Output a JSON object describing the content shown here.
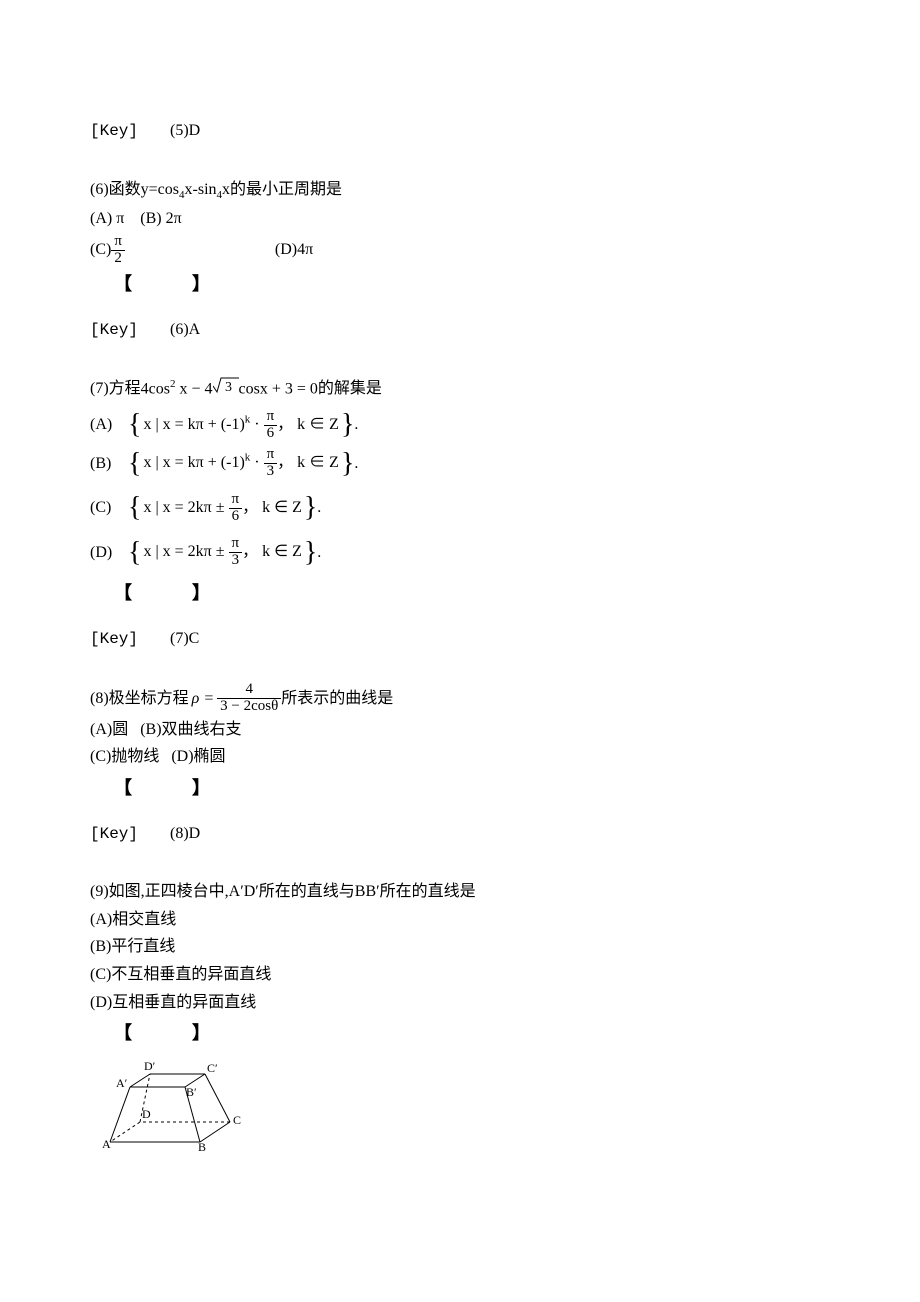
{
  "key_label": "[Key]",
  "bracket_symbol": "【　　】",
  "q5_key": "(5)D",
  "q6": {
    "stem_prefix": "(6)函数y=cos",
    "stem_sub": "4",
    "stem_mid": "x-sin",
    "stem_sub2": "4",
    "stem_suffix": "x的最小正周期是",
    "a_label": "(A)",
    "a_val": "π",
    "b_label": "(B)",
    "b_val": "2π",
    "c_label": "(C)",
    "c_num": "π",
    "c_den": "2",
    "d_label": "(D)",
    "d_val": "4π",
    "key": "(6)A"
  },
  "q7": {
    "stem_prefix": "(7)方程",
    "eq_a": "4cos",
    "eq_exp": "2",
    "eq_b": "x − 4",
    "eq_sqrt": "3",
    "eq_c": "cosx + 3 = 0",
    "stem_suffix": "的解集是",
    "a_label": "(A)",
    "a_body_pre": "x | x = kπ + (-1)",
    "a_body_exp": "k",
    "a_body_mid": " · ",
    "a_num": "π",
    "a_den": "6",
    "a_body_post": "， k ∈ Z",
    "b_label": "(B)",
    "b_body_pre": "x | x = kπ + (-1)",
    "b_body_exp": "k",
    "b_body_mid": " · ",
    "b_num": "π",
    "b_den": "3",
    "b_body_post": "， k ∈ Z",
    "c_label": "(C)",
    "c_body_pre": "x | x = 2kπ ± ",
    "c_num": "π",
    "c_den": "6",
    "c_body_post": "， k ∈ Z",
    "d_label": "(D)",
    "d_body_pre": "x | x = 2kπ ± ",
    "d_num": "π",
    "d_den": "3",
    "d_body_post": "， k ∈ Z",
    "key": "(7)C"
  },
  "q8": {
    "stem_prefix": "(8)极坐标方程",
    "rho": "ρ =",
    "num": "4",
    "den": "3 − 2cosθ",
    "stem_suffix": "所表示的曲线是",
    "a": "(A)圆",
    "b": "(B)双曲线右支",
    "c": "(C)抛物线",
    "d": "(D)椭圆",
    "key": "(8)D"
  },
  "q9": {
    "stem": "(9)如图,正四棱台中,A′D′所在的直线与BB′所在的直线是",
    "a": "(A)相交直线",
    "b": "(B)平行直线",
    "c": "(C)不互相垂直的异面直线",
    "d": "(D)互相垂直的异面直线",
    "labels": {
      "A": "A",
      "B": "B",
      "C": "C",
      "D": "D",
      "Ap": "A′",
      "Bp": "B′",
      "Cp": "C′",
      "Dp": "D′"
    }
  }
}
